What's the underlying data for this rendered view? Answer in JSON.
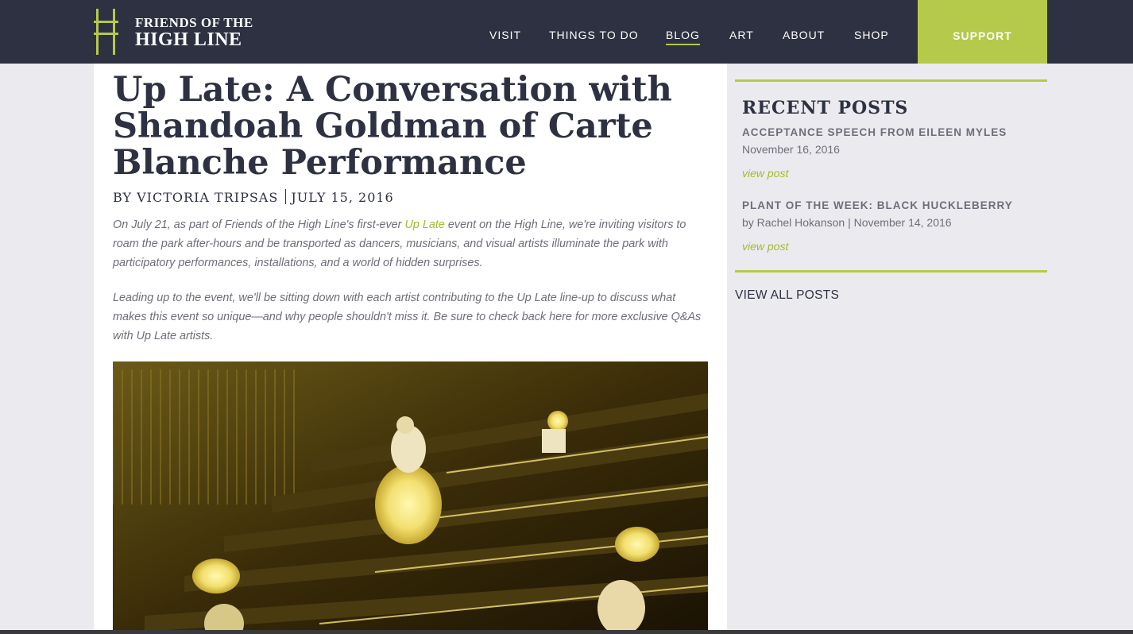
{
  "header": {
    "logo_line1": "FRIENDS OF THE",
    "logo_line2": "HIGH LINE",
    "nav": [
      "VISIT",
      "THINGS TO DO",
      "BLOG",
      "ART",
      "ABOUT",
      "SHOP"
    ],
    "active_nav": "BLOG",
    "support_label": "SUPPORT"
  },
  "article": {
    "title": "Up Late: A Conversation with Shandoah Goldman of Carte Blanche Performance",
    "byline_author": "BY VICTORIA TRIPSAS",
    "byline_date": "JULY 15, 2016",
    "para1_before": "On July 21, as part of Friends of the High Line's first-ever ",
    "para1_link": "Up Late",
    "para1_after": " event on the High Line, we're inviting visitors to roam the park after-hours and be transported as dancers, musicians, and visual artists illuminate the park with participatory performances, installations, and a world of hidden surprises.",
    "para2": "Leading up to the event, we'll be sitting down with each artist contributing to the Up Late line-up to discuss what makes this event so unique—and why people shouldn't miss it. Be sure to check back here for more exclusive Q&As with Up Late artists."
  },
  "sidebar": {
    "heading": "RECENT POSTS",
    "posts": [
      {
        "title": "ACCEPTANCE SPEECH FROM EILEEN MYLES",
        "meta": "November 16, 2016",
        "link": "view post"
      },
      {
        "title": "PLANT OF THE WEEK: BLACK HUCKLEBERRY",
        "meta": "by Rachel Hokanson | November 14, 2016",
        "link": "view post"
      }
    ],
    "view_all": "VIEW ALL POSTS"
  },
  "colors": {
    "header_bg": "#2d3142",
    "accent": "#b5c94a",
    "link": "#a4b82f",
    "text_gray": "#6e6e7a",
    "page_bg": "#ebebef"
  }
}
